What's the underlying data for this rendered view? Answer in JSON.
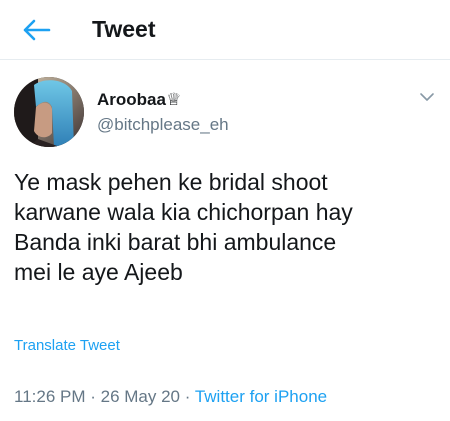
{
  "header": {
    "back_icon": "arrow-left-icon",
    "title": "Tweet"
  },
  "author": {
    "display_name": "Aroobaa♕",
    "handle": "@bitchplease_eh",
    "avatar": "profile-photo"
  },
  "tweet": {
    "lines": [
      "Ye mask pehen ke bridal shoot",
      "karwane wala kia chichorpan hay",
      "Banda inki barat bhi ambulance",
      "mei le aye Ajeeb"
    ],
    "translate_label": "Translate Tweet",
    "time": "11:26 PM",
    "separator": " · ",
    "date": "26 May 20",
    "source": "Twitter for iPhone"
  },
  "colors": {
    "accent": "#1da1f2",
    "secondary_text": "#657786",
    "primary_text": "#14171a"
  }
}
